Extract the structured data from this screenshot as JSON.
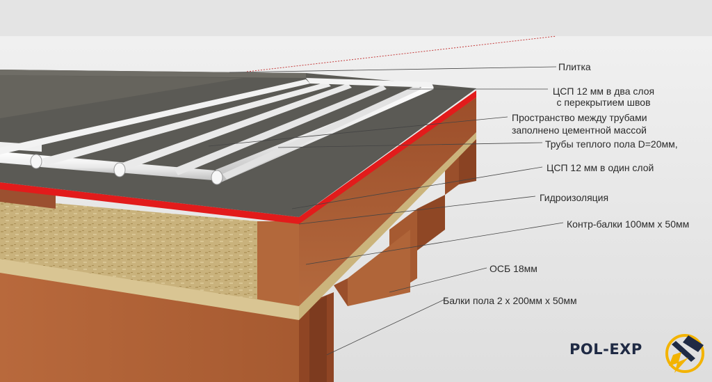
{
  "labels": {
    "tile": "Плитка",
    "dsp_two_layers_1": "ЦСП 12 мм в два слоя",
    "dsp_two_layers_2": "с перекрытием швов",
    "space_between_1": "Пространство между трубами",
    "space_between_2": "заполнено цементной массой",
    "pipes": "Трубы теплого пола D=20мм,",
    "dsp_one_layer": "ЦСП 12 мм в один слой",
    "waterproofing": "Гидроизоляция",
    "counter_beams": "Контр-балки 100мм х 50мм",
    "osb": "ОСБ 18мм",
    "floor_beams": "Балки пола 2 х 200мм х 50мм"
  },
  "logo": {
    "text": "POL-EXP",
    "icon": "hammer-lightning-icon"
  },
  "colors": {
    "background": "#e9e9e9",
    "wood": "#a9562e",
    "osb": "#c8b27e",
    "cement": "#5b5a55",
    "waterproofing": "#e01818",
    "pipes": "#f2f2f2",
    "leader_lines": "#444444",
    "logo_dark": "#1f2a44",
    "logo_accent": "#f3b300"
  }
}
